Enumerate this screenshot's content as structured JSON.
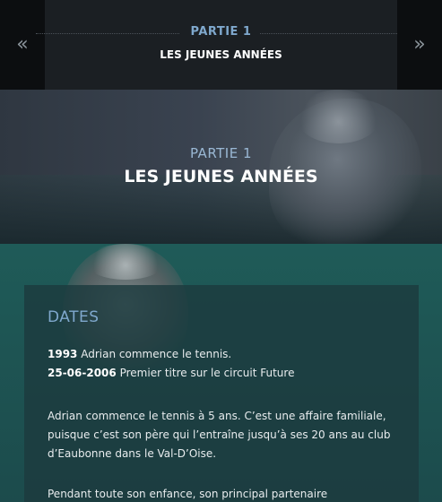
{
  "topbar": {
    "prev_arrow": "«",
    "next_arrow": "»",
    "part_label": "PARTIE 1",
    "title": "LES JEUNES ANNÉES"
  },
  "hero": {
    "part_label": "PARTIE 1",
    "title": "LES JEUNES ANNÉES"
  },
  "section": {
    "heading": "DATES",
    "events": [
      {
        "date": "1993",
        "text": "Adrian commence le tennis."
      },
      {
        "date": "25-06-2006",
        "text": "Premier titre sur le circuit Future"
      }
    ],
    "paragraphs": [
      "Adrian commence le tennis à 5 ans. C’est une affaire familiale, puisque c’est son père qui l’entraîne jusqu’à ses 20 ans au club d’Eaubonne dans le Val-D’Oise.",
      "Pendant toute son enfance, son principal partenaire d’entraînement"
    ]
  },
  "colors": {
    "accent_blue": "#7fa8cd",
    "teal_background": "#1f5b58",
    "dark_bar": "#1b1f23"
  }
}
